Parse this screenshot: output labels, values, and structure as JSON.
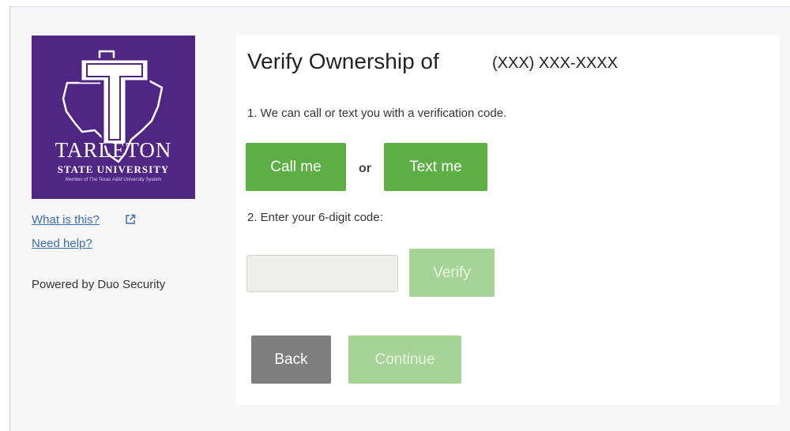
{
  "logo": {
    "name": "TARLETON",
    "subtitle": "STATE UNIVERSITY",
    "tagline": "Member of The Texas A&M University System",
    "letter": "T",
    "color": "#4f2683"
  },
  "sidebar": {
    "what_is_this": "What is this?",
    "what_is_this_icon": "external-link-icon",
    "need_help": "Need help?",
    "powered_by": "Powered by Duo Security"
  },
  "panel": {
    "title": "Verify Ownership of",
    "phone": "(XXX) XXX-XXXX",
    "step1": "1. We can call or text you with a verification code.",
    "call_label": "Call me",
    "or_label": "or",
    "text_label": "Text me",
    "step2": "2. Enter your 6-digit code:",
    "code_value": "",
    "verify_label": "Verify",
    "back_label": "Back",
    "continue_label": "Continue"
  },
  "colors": {
    "primary_green": "#5cae45",
    "disabled_green": "#a6d496",
    "back_gray": "#7e7e7e",
    "link_blue": "#3b6ea8"
  }
}
